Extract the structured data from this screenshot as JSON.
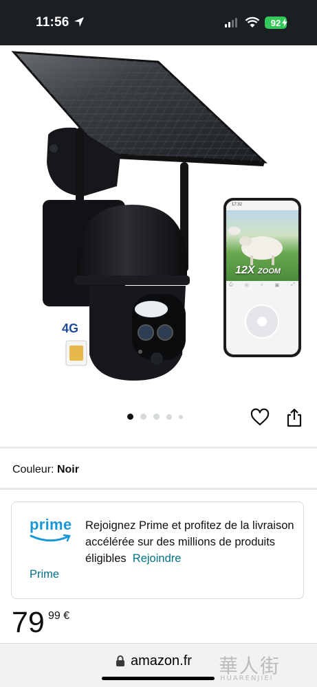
{
  "status_bar": {
    "time": "11:56",
    "battery": "92"
  },
  "product": {
    "image_alt": "Black 4G solar security camera with app zoom preview",
    "zoom_badge": "12X",
    "zoom_badge_suffix": "ZOOM",
    "sim_label": "4G",
    "carousel": {
      "total": 5,
      "active": 1
    }
  },
  "variant": {
    "label": "Couleur:",
    "value": "Noir"
  },
  "prime": {
    "logo_text": "prime",
    "message": "Rejoignez Prime et profitez de la livraison accélérée sur des millions de produits éligibles",
    "link_part1": "Rejoindre",
    "link_part2": "Prime"
  },
  "price": {
    "whole": "79",
    "fraction": "99",
    "currency": "€"
  },
  "browser": {
    "url": "amazon.fr"
  },
  "watermark": {
    "cjk": "華人街",
    "latin": "HUARENJIEI"
  },
  "colors": {
    "prime_blue": "#1a98d5",
    "link": "#007185",
    "status_bar_bg": "#1a1f24",
    "battery": "#34c759"
  }
}
